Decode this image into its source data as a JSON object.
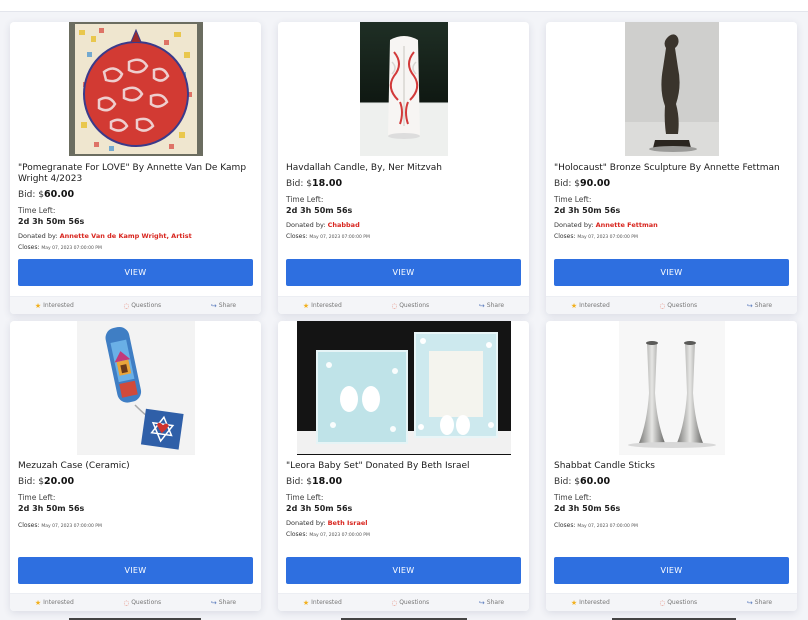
{
  "labels": {
    "bid": "Bid:",
    "time_left": "Time Left:",
    "donated_by": "Donated by:",
    "closes": "Closes:",
    "view": "VIEW",
    "interested": "Interested",
    "questions": "Questions",
    "share": "Share"
  },
  "items": [
    {
      "title": "\"Pomegranate For LOVE\" By Annette Van De Kamp Wright 4/2023",
      "price": "60.00",
      "time_left": "2d 3h 50m 56s",
      "donor": "Annette Van de Kamp Wright, Artist",
      "closes": "May 07, 2023 07:00:00 PM"
    },
    {
      "title": "Havdallah Candle, By, Ner Mitzvah",
      "price": "18.00",
      "time_left": "2d 3h 50m 56s",
      "donor": "Chabbad",
      "closes": "May 07, 2023 07:00:00 PM"
    },
    {
      "title": "\"Holocaust\" Bronze Sculpture By Annette Fettman",
      "price": "90.00",
      "time_left": "2d 3h 50m 56s",
      "donor": "Annette Fettman",
      "closes": "May 07, 2023 07:00:00 PM"
    },
    {
      "title": "Mezuzah Case (Ceramic)",
      "price": "20.00",
      "time_left": "2d 3h 50m 56s",
      "closes": "May 07, 2023 07:00:00 PM"
    },
    {
      "title": "\"Leora Baby Set\" Donated By Beth Israel",
      "price": "18.00",
      "time_left": "2d 3h 50m 56s",
      "donor": "Beth Israel",
      "closes": "May 07, 2023 07:00:00 PM"
    },
    {
      "title": "Shabbat Candle Sticks",
      "price": "60.00",
      "time_left": "2d 3h 50m 56s",
      "closes": "May 07, 2023 07:00:00 PM"
    }
  ],
  "colors": {
    "accent": "#2e6fe0",
    "donor": "#d8261f",
    "star": "#f2b01e"
  }
}
